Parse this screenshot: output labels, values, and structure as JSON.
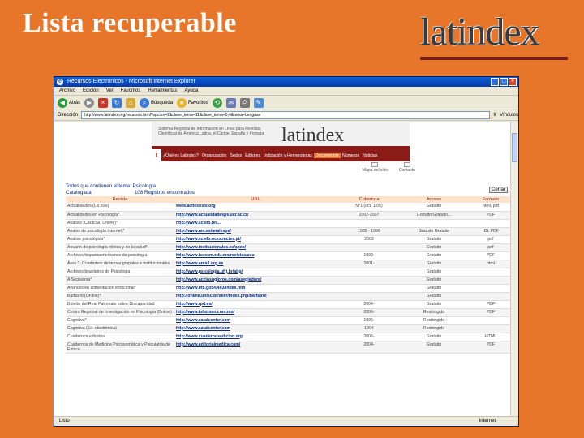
{
  "slide": {
    "title": "Lista recuperable",
    "logo": "latindex"
  },
  "window": {
    "title": "Recursos Electrónicos - Microsoft Internet Explorer",
    "menu": [
      "Archivo",
      "Edición",
      "Ver",
      "Favoritos",
      "Herramientas",
      "Ayuda"
    ],
    "toolbar": {
      "back": "Atrás",
      "search": "Búsqueda",
      "favorites": "Favoritos"
    },
    "address_label": "Dirección",
    "address": "http://www.latindex.org/recursos.html?opcion=2&clave_tema=11&clave_tema=5,4&tema=Lenguas",
    "go": "Ir",
    "links": "Vínculos",
    "status": "Listo",
    "zone": "Internet"
  },
  "site": {
    "banner_text": "Sistema Regional de Información en Línea para Revistas Científicas de América Latina, el Caribe, España y Portugal",
    "banner_logo": "latindex",
    "nav": [
      "¿Qué es Latindex?",
      "Organización",
      "Sedes",
      "Editores",
      "Indización y Hemerotecas",
      "Documentos",
      "Números",
      "Noticias"
    ],
    "subicons": [
      "Mapa del sitio",
      "Contacto"
    ],
    "close": "Cerrar",
    "result_line1": "Todos que contienen el tema: Psicología",
    "result_label": "Catalogada",
    "result_count": "108 Registros encontrados"
  },
  "table": {
    "headers": [
      "Revista",
      "URL",
      "Cobertura",
      "Acceso",
      "Formato"
    ],
    "rows": [
      [
        "Actualidades (Lis.tras)",
        "www.achesosts.org",
        "N°1 (oct. 1/05)",
        "Gratuito",
        "html, pdf"
      ],
      [
        "Actualidades en Psicología*",
        "http://www.actualidadesps.ucr.ac.cr/",
        "2002-2007",
        "Gratuito/Gratuito...",
        "PDF"
      ],
      [
        "Análisis (Caracas, Online)*",
        "http://www.scielo.br/...",
        "",
        "",
        ""
      ],
      [
        "Anales de psicología Internet)*",
        "http://www.um.es/analesps/",
        "1985 - 1996",
        "Gratuito Gratuito",
        "-DL PDF"
      ],
      [
        "Análise psicológica*",
        "http://www.scielo.oces.mctes.pt/",
        "2003",
        "Gratuito",
        "pdf"
      ],
      [
        "Anuario de psicología clínica y de la salud*",
        "http://www.institucionales.es/apcs/",
        "",
        "Gratuito",
        "pdf"
      ],
      [
        "Archivos hispanoamericanos de psicología",
        "http://www.isocsm.edu.mx/revistas/asc",
        "1993-",
        "Gratuito",
        "PDF"
      ],
      [
        "Área 3. Cuadernos de temas grupales e institucionales",
        "http://www.area3.org.es",
        "2001-",
        "Gratuito",
        "html"
      ],
      [
        "Archivos brasileiros de Psicologia",
        "http://www.psicologia.ufrj.br/abp/",
        "",
        "Gratuito",
        ""
      ],
      [
        "A Segladora*",
        "http://www.acclosugloros.com/asegladora/",
        "",
        "Gratuito",
        ""
      ],
      [
        "Avances en alimentación emocional*",
        "http://www.inti.gob/0403/index.htm",
        "",
        "Gratuito",
        ""
      ],
      [
        "Barbarói (Online)*",
        "http://online.unisc.br/seer/index.php/barbaroi",
        "",
        "Gratuito",
        ""
      ],
      [
        "Boletín del Real Patronato sobre Discapacidad",
        "http://www.rpd.es/",
        "2004-",
        "Gratuito",
        "PDF"
      ],
      [
        "Centro Regional de Investigación en Psicología (Online)",
        "http://www.inhuman.com.mx/",
        "2006-",
        "Restringido",
        "PDF"
      ],
      [
        "Cognitiva*",
        "http://www.catalcenter.com",
        "1995-",
        "Restringido",
        ""
      ],
      [
        "Cognitiva (Ed. electrónica)",
        "http://www.catalcenter.com",
        "1994",
        "Restringido",
        ""
      ],
      [
        "Cuadernos edicióna",
        "http://www.cuadernosedicion.org",
        "2006-",
        "Gratuito",
        "HTML"
      ],
      [
        "Cuadernos de Medicina Psicosomática y Psiquiatría de Enlace",
        "http://www.editorialmedica.com/",
        "2004-",
        "Gratuito",
        "PDF"
      ]
    ]
  }
}
